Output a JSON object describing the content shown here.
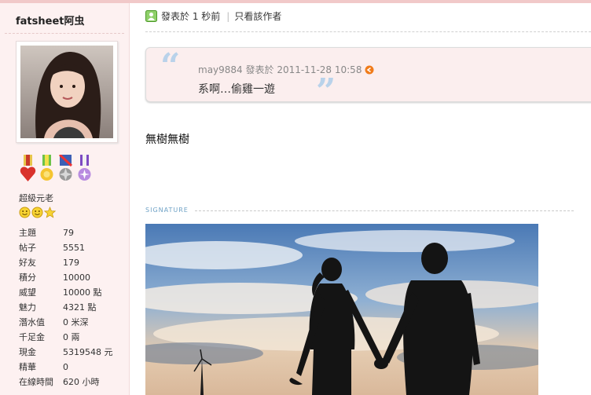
{
  "profile": {
    "username": "fatsheet阿虫",
    "rank_title": "超級元老",
    "medals": [
      "heart-medal-icon",
      "sun-medal-icon",
      "crossed-medal-icon",
      "ribbon-medal-icon"
    ],
    "rank_stars": [
      "smile-icon",
      "smile-icon",
      "star-icon"
    ],
    "stats": [
      {
        "label": "主題",
        "value": "79"
      },
      {
        "label": "帖子",
        "value": "5551"
      },
      {
        "label": "好友",
        "value": "179"
      },
      {
        "label": "積分",
        "value": "10000"
      },
      {
        "label": "威望",
        "value": "10000 點"
      },
      {
        "label": "魅力",
        "value": "4321 點"
      },
      {
        "label": "潛水值",
        "value": "0 米深"
      },
      {
        "label": "千足金",
        "value": "0 兩"
      },
      {
        "label": "現金",
        "value": "5319548 元"
      },
      {
        "label": "精華",
        "value": "0"
      },
      {
        "label": "在線時間",
        "value": "620 小時"
      }
    ]
  },
  "post": {
    "posted_label": "發表於 1 秒前",
    "author_only_link": "只看該作者",
    "quote": {
      "author_meta": "may9884 發表於 2011-11-28 10:58",
      "text": "系啊…偷雞一遊"
    },
    "message": "無樹無樹",
    "signature_label": "SIGNATURE"
  },
  "colors": {
    "sidebar_bg": "#fdf1f1",
    "quote_bg": "#fbeeee",
    "quote_mark": "#b9d2ea",
    "signature_label": "#6fa2c6"
  }
}
